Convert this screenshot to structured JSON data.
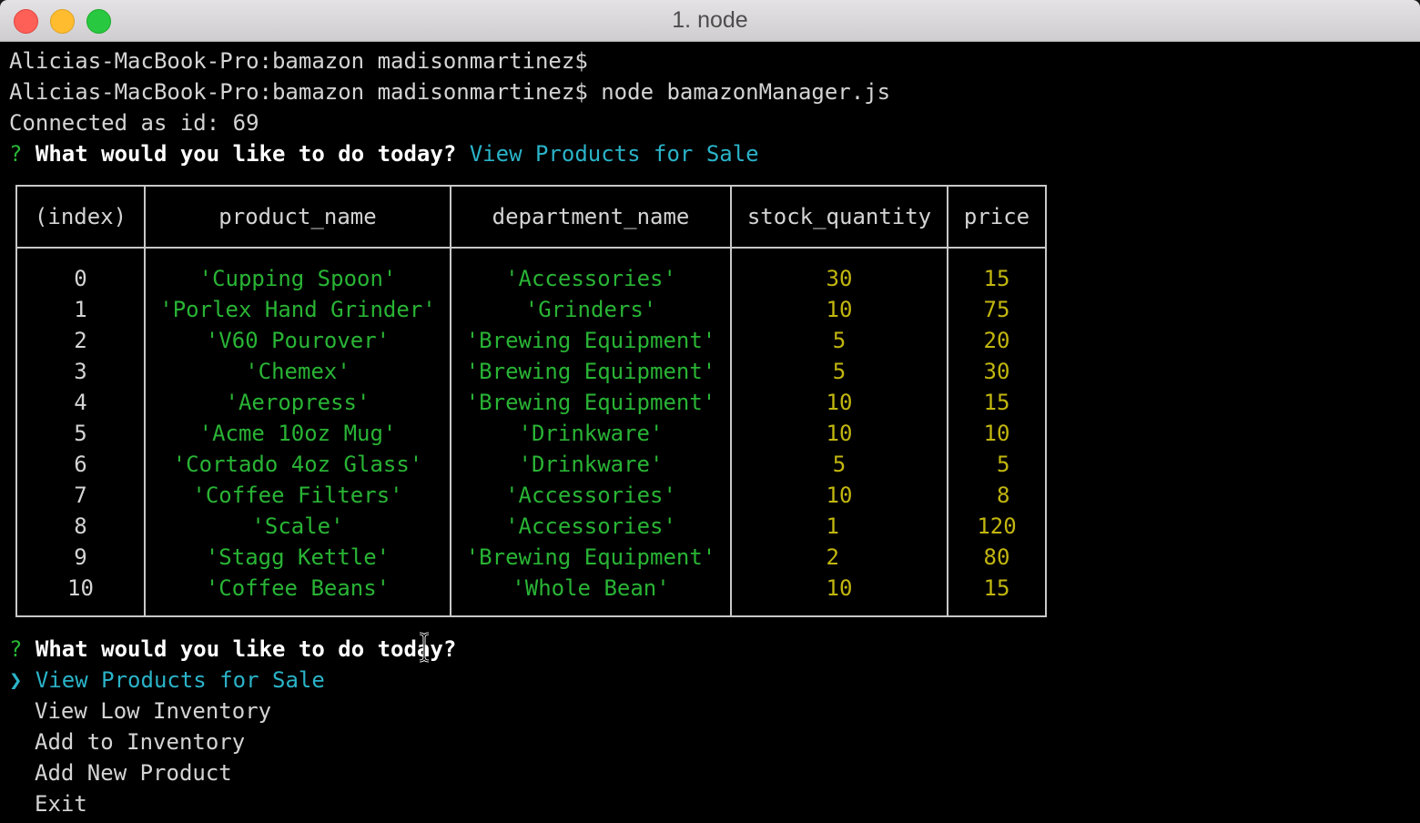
{
  "window": {
    "title": "1. node"
  },
  "terminal": {
    "lines": [
      "Alicias-MacBook-Pro:bamazon madisonmartinez$",
      "Alicias-MacBook-Pro:bamazon madisonmartinez$ node bamazonManager.js",
      "Connected as id: 69"
    ],
    "prompt_symbol": "?",
    "question": "What would you like to do today?",
    "first_answer": "View Products for Sale",
    "pointer": "❯",
    "menu": [
      "View Products for Sale",
      "View Low Inventory",
      "Add to Inventory",
      "Add New Product",
      "Exit"
    ]
  },
  "table": {
    "headers": [
      "(index)",
      "product_name",
      "department_name",
      "stock_quantity",
      "price"
    ],
    "rows": [
      [
        "0",
        "'Cupping Spoon'",
        "'Accessories'",
        "30",
        "15"
      ],
      [
        "1",
        "'Porlex Hand Grinder'",
        "'Grinders'",
        "10",
        "75"
      ],
      [
        "2",
        "'V60 Pourover'",
        "'Brewing Equipment'",
        "5",
        "20"
      ],
      [
        "3",
        "'Chemex'",
        "'Brewing Equipment'",
        "5",
        "30"
      ],
      [
        "4",
        "'Aeropress'",
        "'Brewing Equipment'",
        "10",
        "15"
      ],
      [
        "5",
        "'Acme 10oz Mug'",
        "'Drinkware'",
        "10",
        "10"
      ],
      [
        "6",
        "'Cortado 4oz Glass'",
        "'Drinkware'",
        "5",
        " 5"
      ],
      [
        "7",
        "'Coffee Filters'",
        "'Accessories'",
        "10",
        " 8"
      ],
      [
        "8",
        "'Scale'",
        "'Accessories'",
        "1 ",
        "120"
      ],
      [
        "9",
        "'Stagg Kettle'",
        "'Brewing Equipment'",
        "2 ",
        "80"
      ],
      [
        "10",
        "'Coffee Beans'",
        "'Whole Bean'",
        "10",
        "15"
      ]
    ]
  },
  "colors": {
    "background": "#000000",
    "prompt_green": "#29b435",
    "answer_cyan": "#2ab3c8",
    "number_yellow": "#c2b60f",
    "text_gray": "#d4d4d4"
  }
}
